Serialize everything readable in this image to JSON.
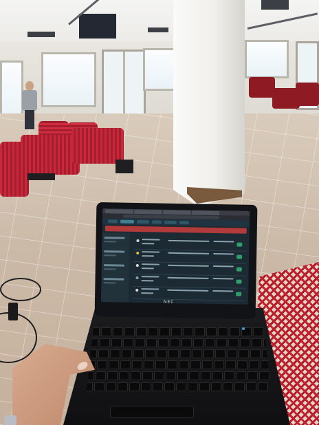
{
  "scene": {
    "laptop_brand": "NEC"
  },
  "colors": {
    "bench_red": "#c8283a",
    "screen_background": "#1c2a33",
    "alert_banner": "#b23a3a",
    "floor_tile": "#cbb9a7"
  }
}
